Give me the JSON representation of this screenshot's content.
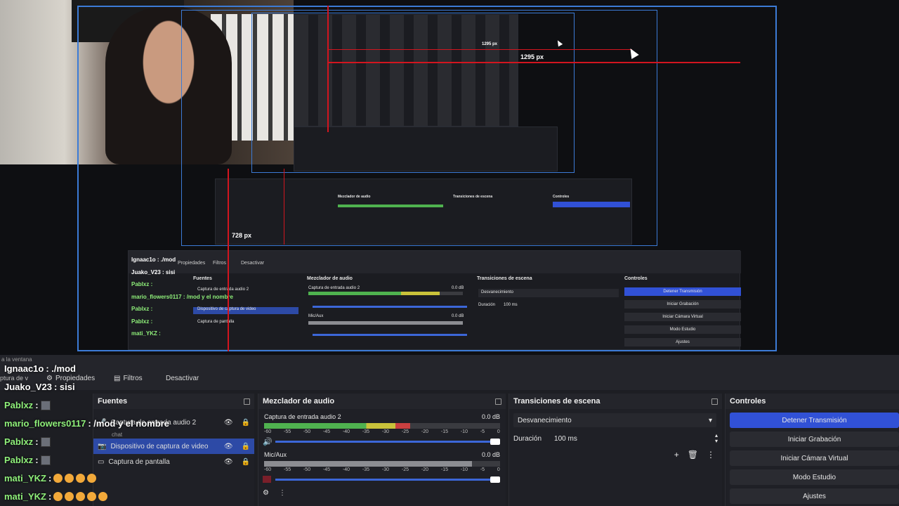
{
  "preview": {
    "px_labels": [
      "1295 px",
      "1295 px",
      "728 px"
    ],
    "mini": {
      "mid": {
        "sources": "Fuentes",
        "mixer": "Mezclador de audio",
        "transitions": "Transiciones de escena",
        "controls": "Controles",
        "fade": "Desvanecimiento",
        "duration_label": "Duración",
        "duration": "100 ms",
        "src1": "Captura de entrada audio 2",
        "src2": "Dispositivo de captura de video",
        "src3": "Captura de pantalla",
        "ch1": "Captura de entrada audio 2",
        "ch1_db": "0.0 dB",
        "ch2": "Mic/Aux",
        "ch2_db": "0.0 dB",
        "btns": [
          "Detener Transmisión",
          "Iniciar Grabación",
          "Iniciar Cámara Virtual",
          "Modo Estudio",
          "Ajustes"
        ],
        "props": "Propiedades",
        "filters": "Filtros",
        "deactivate": "Desactivar",
        "chat": [
          "Ignaac1o : ./mod",
          "Juako_V23 : sisi",
          "Pablxz :",
          "mario_flowers0117 : /mod y el nombre",
          "Pablxz :",
          "Pablxz :",
          "mati_YKZ :",
          "mati_YKZ :"
        ]
      }
    }
  },
  "toolbar": {
    "window_hint": "a la ventana",
    "props_label": "Propiedades",
    "filters_label": "Filtros",
    "deactivate_label": "Desactivar",
    "capture_hint": "ptura de v"
  },
  "sources": {
    "title": "Fuentes",
    "items": [
      {
        "label": "Captura de entrada audio 2",
        "sub": "chat"
      },
      {
        "label": "Dispositivo de captura de video"
      },
      {
        "label": "Captura de pantalla"
      }
    ]
  },
  "mixer": {
    "title": "Mezclador de audio",
    "channels": [
      {
        "name": "Captura de entrada audio 2",
        "db": "0.0 dB",
        "level": 0.62
      },
      {
        "name": "Mic/Aux",
        "db": "0.0 dB",
        "level": 0.88
      }
    ],
    "ticks": [
      "-60",
      "-55",
      "-50",
      "-45",
      "-40",
      "-35",
      "-30",
      "-25",
      "-20",
      "-15",
      "-10",
      "-5",
      "0"
    ]
  },
  "transitions": {
    "title": "Transiciones de escena",
    "selected": "Desvanecimiento",
    "duration_label": "Duración",
    "duration": "100 ms"
  },
  "controls": {
    "title": "Controles",
    "buttons": [
      "Detener Transmisión",
      "Iniciar Grabación",
      "Iniciar Cámara Virtual",
      "Modo Estudio",
      "Ajustes"
    ]
  },
  "chat": [
    {
      "user": "Ignaac1o",
      "msg": ": ./mod"
    },
    {
      "user": "Juako_V23",
      "msg": ": sisi"
    },
    {
      "user": "Pablxz",
      "msg": ":"
    },
    {
      "user": "mario_flowers0117",
      "msg": ": /mod y el nombre"
    },
    {
      "user": "Pablxz",
      "msg": ":"
    },
    {
      "user": "Pablxz",
      "msg": ":"
    },
    {
      "user": "mati_YKZ",
      "msg": ":"
    },
    {
      "user": "mati_YKZ",
      "msg": ":"
    }
  ],
  "colors": {
    "accent": "#3151d6",
    "record_red": "#d2151f",
    "selection_border": "#3c7bd6"
  }
}
